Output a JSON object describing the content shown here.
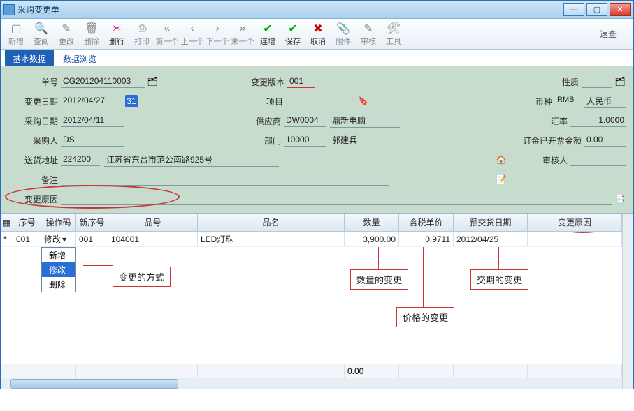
{
  "window": {
    "title": "采购变更单"
  },
  "toolbar": {
    "items": [
      {
        "label": "新增",
        "enabled": false
      },
      {
        "label": "查阅",
        "enabled": false
      },
      {
        "label": "更改",
        "enabled": false
      },
      {
        "label": "删除",
        "enabled": false
      },
      {
        "label": "删行",
        "enabled": true
      },
      {
        "label": "打印",
        "enabled": false
      },
      {
        "label": "第一个",
        "enabled": false
      },
      {
        "label": "上一个",
        "enabled": false
      },
      {
        "label": "下一个",
        "enabled": false
      },
      {
        "label": "末一个",
        "enabled": false
      },
      {
        "label": "连增",
        "enabled": true
      },
      {
        "label": "保存",
        "enabled": true
      },
      {
        "label": "取消",
        "enabled": true
      },
      {
        "label": "附件",
        "enabled": false
      },
      {
        "label": "审核",
        "enabled": false
      },
      {
        "label": "工具",
        "enabled": false
      }
    ],
    "quicksearch_label": "速查"
  },
  "tabs": [
    {
      "label": "基本数据",
      "active": true
    },
    {
      "label": "数据浏览",
      "active": false
    }
  ],
  "form": {
    "order_no": {
      "label": "单号",
      "value": "CG201204110003"
    },
    "change_ver": {
      "label": "变更版本",
      "value": "001"
    },
    "nature": {
      "label": "性质",
      "value": ""
    },
    "change_date": {
      "label": "变更日期",
      "value": "2012/04/27"
    },
    "project": {
      "label": "项目",
      "value": ""
    },
    "currency": {
      "label": "币种",
      "code": "RMB",
      "name": "人民币"
    },
    "purchase_date": {
      "label": "采购日期",
      "value": "2012/04/11"
    },
    "supplier": {
      "label": "供应商",
      "code": "DW0004",
      "name": "鼎新电脑"
    },
    "rate": {
      "label": "汇率",
      "value": "1.0000"
    },
    "buyer": {
      "label": "采购人",
      "value": "DS"
    },
    "dept": {
      "label": "部门",
      "code": "10000",
      "name": "郭建兵"
    },
    "deposit_amt": {
      "label": "订金已开票金额",
      "value": "0.00"
    },
    "ship_addr": {
      "label": "送货地址",
      "postal": "224200",
      "addr": "江苏省东台市范公南路925号"
    },
    "reviewer": {
      "label": "审核人",
      "value": ""
    },
    "note": {
      "label": "备注",
      "value": ""
    },
    "change_reason": {
      "label": "变更原因",
      "value": ""
    }
  },
  "grid": {
    "columns": [
      "",
      "序号",
      "操作码",
      "新序号",
      "品号",
      "品名",
      "数量",
      "含税单价",
      "预交货日期",
      "变更原因"
    ],
    "rows": [
      {
        "mark": "*",
        "seq": "001",
        "op": "修改",
        "nseq": "001",
        "pno": "104001",
        "pname": "LED灯珠",
        "qty": "3,900.00",
        "price": "0.9711",
        "date": "2012/04/25",
        "reason": ""
      }
    ],
    "footer_total_qty": "0.00",
    "op_dropdown": [
      "新增",
      "修改",
      "删除"
    ],
    "op_selected_index": 1
  },
  "annotations": {
    "change_method": "变更的方式",
    "qty_change": "数量的变更",
    "price_change": "价格的变更",
    "date_change": "交期的变更"
  }
}
